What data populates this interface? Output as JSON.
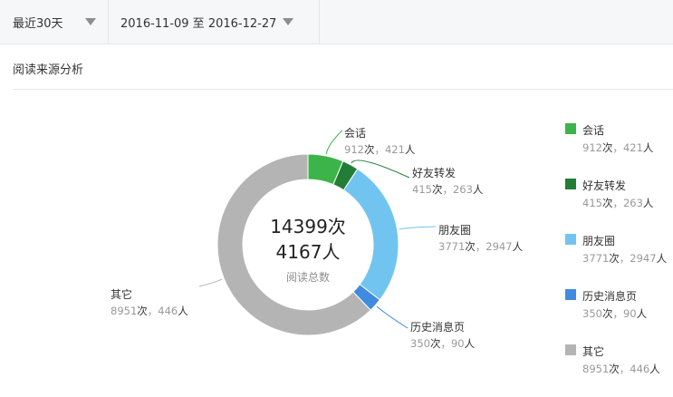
{
  "filters": {
    "range": "最近30天",
    "dates": "2016-11-09 至 2016-12-27"
  },
  "section_title": "阅读来源分析",
  "unit_times": "次",
  "unit_people": "人",
  "center": {
    "times": "14399次",
    "people": "4167人",
    "label": "阅读总数"
  },
  "sources": [
    {
      "name": "会话",
      "times": "912",
      "people": "421",
      "color": "#3cb449"
    },
    {
      "name": "好友转发",
      "times": "415",
      "people": "263",
      "color": "#237d35"
    },
    {
      "name": "朋友圈",
      "times": "3771",
      "people": "2947",
      "color": "#72c4f0"
    },
    {
      "name": "历史消息页",
      "times": "350",
      "people": "90",
      "color": "#3f8be0"
    },
    {
      "name": "其它",
      "times": "8951",
      "people": "446",
      "color": "#b4b4b4"
    }
  ],
  "chart_data": {
    "type": "pie",
    "categories": [
      "会话",
      "好友转发",
      "朋友圈",
      "历史消息页",
      "其它"
    ],
    "values": [
      912,
      415,
      3771,
      350,
      8951
    ],
    "people": [
      421,
      263,
      2947,
      90,
      446
    ],
    "total_times": 14399,
    "total_people": 4167,
    "donut": true,
    "legend": "right"
  }
}
